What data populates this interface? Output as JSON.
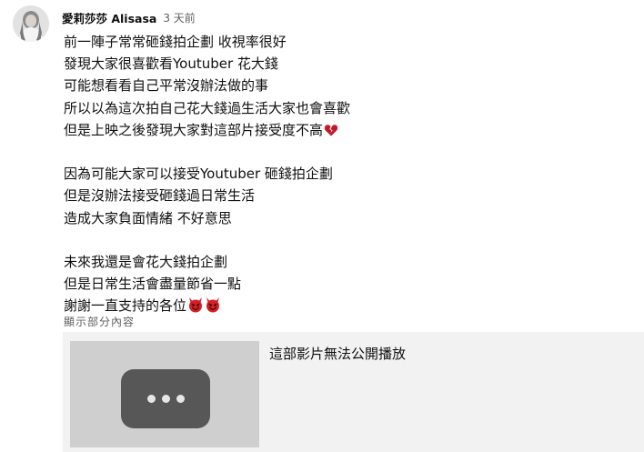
{
  "comment": {
    "author": "愛莉莎莎 Alisasa",
    "timestamp": "3 天前",
    "lines": [
      "前一陣子常常砸錢拍企劃 收視率很好",
      "發現大家很喜歡看Youtuber 花大錢",
      "可能想看看自己平常沒辦法做的事",
      "所以以為這次拍自己花大錢過生活大家也會喜歡",
      "但是上映之後發現大家對這部片接受度不高",
      "",
      "因為可能大家可以接受Youtuber 砸錢拍企劃",
      "但是沒辦法接受砸錢過日常生活",
      "造成大家負面情緒 不好意思",
      "",
      "未來我還是會花大錢拍企劃",
      "但是日常生活會盡量節省一點",
      "謝謝一直支持的各位"
    ],
    "emojis": {
      "line_5": "broken-heart-icon",
      "line_13": [
        "smiling-devil-icon",
        "smiling-devil-icon"
      ]
    },
    "show_less_label": "顯示部分內容"
  },
  "video_card": {
    "title": "這部影片無法公開播放",
    "thumbnail_icon": "more-horizontal-icon"
  },
  "colors": {
    "text": "#0f0f0f",
    "secondary_text": "#606060",
    "card_background": "#f2f2f2",
    "thumbnail_background": "#cfcfcf",
    "thumbnail_button": "#575757",
    "broken_heart": "#c4192b",
    "devil_face": "#d81f26"
  }
}
